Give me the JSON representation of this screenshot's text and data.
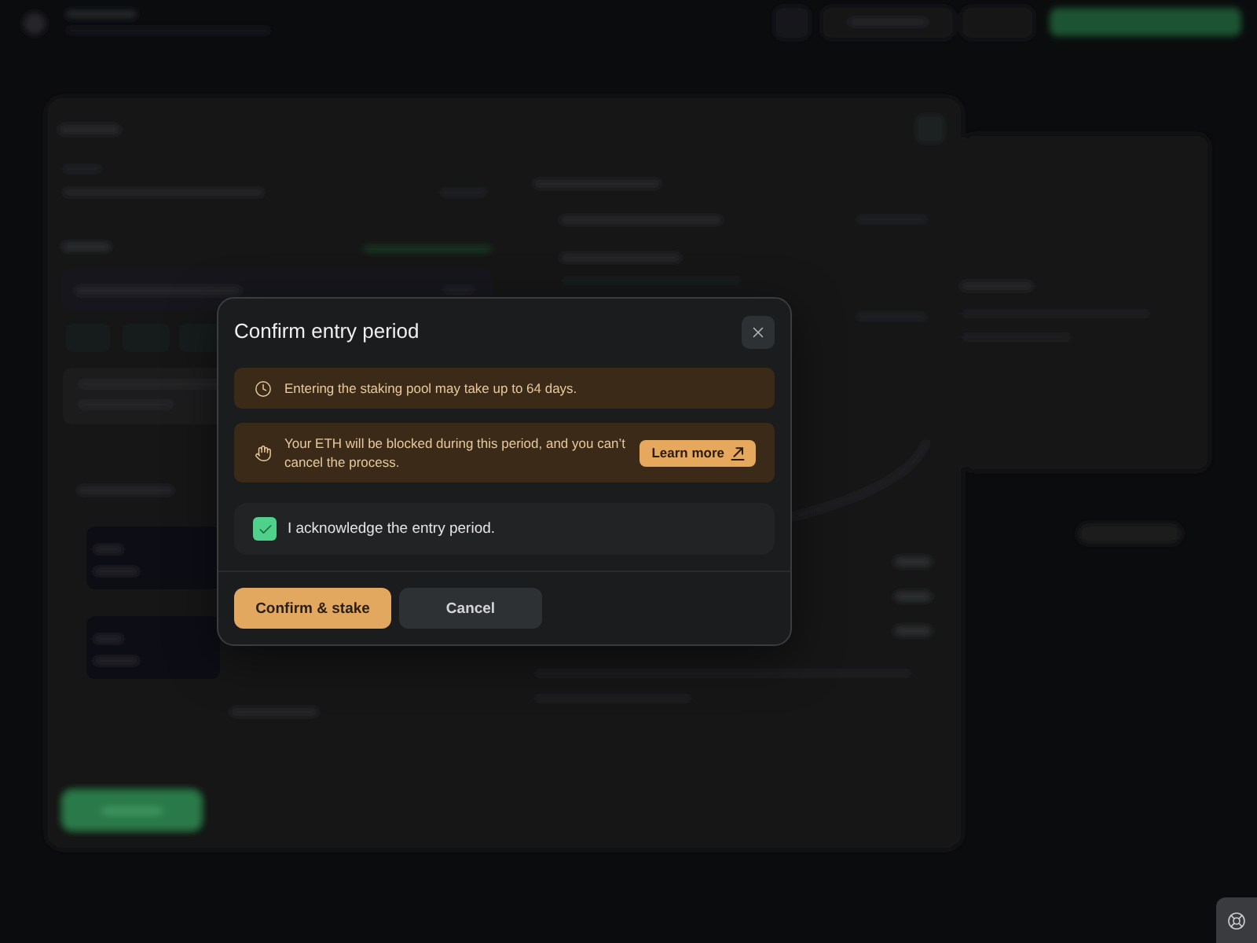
{
  "dialog": {
    "title": "Confirm entry period",
    "notices": [
      {
        "kind": "period",
        "text": "Entering the staking pool may take up to 64 days."
      },
      {
        "kind": "blocked",
        "text": "Your ETH will be blocked during this period, and you can’t cancel the process.",
        "link": "Learn more"
      }
    ],
    "acknowledgement": {
      "label": "I acknowledge the entry period.",
      "checked": true
    },
    "buttons": [
      {
        "label": "Confirm & stake",
        "kind": "primary"
      },
      {
        "label": "Cancel",
        "kind": "secondary"
      }
    ]
  }
}
